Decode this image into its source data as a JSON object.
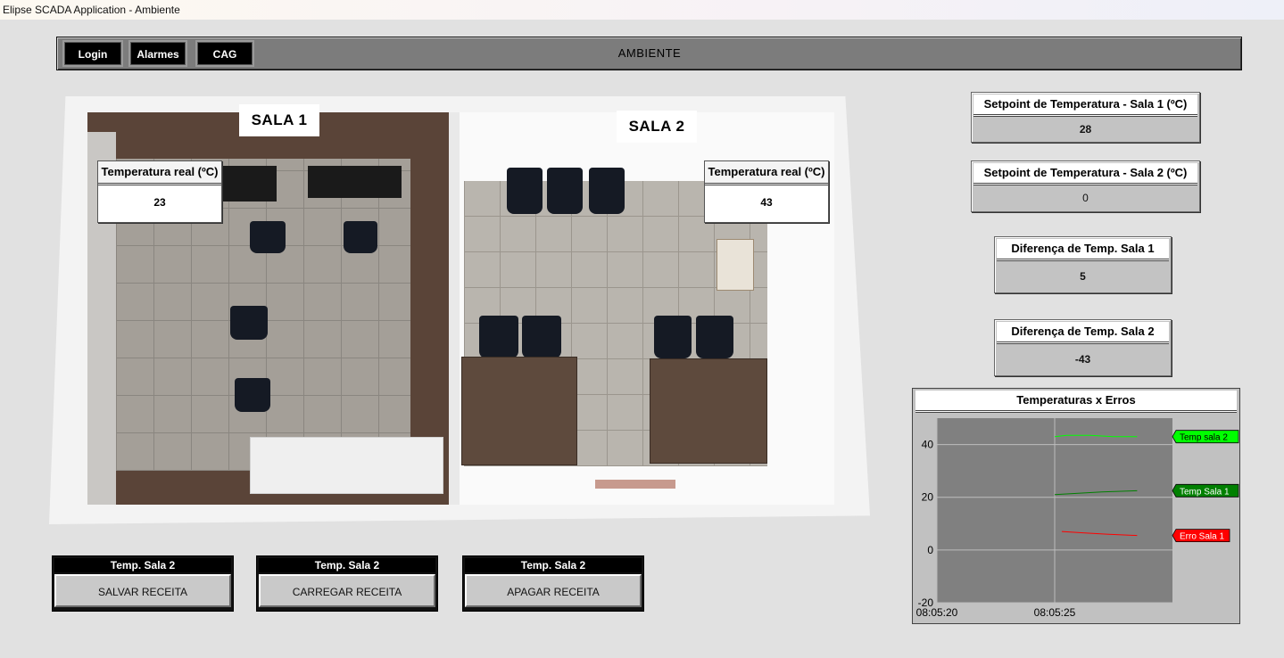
{
  "window": {
    "title": "Elipse SCADA Application - Ambiente"
  },
  "topbar": {
    "buttons": [
      {
        "label": "Login"
      },
      {
        "label": "Alarmes"
      },
      {
        "label": "CAG"
      }
    ],
    "title": "AMBIENTE"
  },
  "plan": {
    "sala1": {
      "label": "SALA 1",
      "temp_title": "Temperatura real (ºC)",
      "temp_value": "23"
    },
    "sala2": {
      "label": "SALA 2",
      "temp_title": "Temperatura real (ºC)",
      "temp_value": "43"
    }
  },
  "panels": {
    "setpoint1": {
      "title": "Setpoint de Temperatura - Sala 1 (ºC)",
      "value": "28"
    },
    "setpoint2": {
      "title": "Setpoint de Temperatura - Sala 2 (ºC)",
      "value": "0"
    },
    "diff1": {
      "title": "Diferença de Temp. Sala 1",
      "value": "5"
    },
    "diff2": {
      "title": "Diferença de Temp. Sala 2",
      "value": "-43"
    }
  },
  "recipes": [
    {
      "header": "Temp. Sala 2",
      "button": "SALVAR RECEITA"
    },
    {
      "header": "Temp. Sala 2",
      "button": "CARREGAR RECEITA"
    },
    {
      "header": "Temp. Sala 2",
      "button": "APAGAR RECEITA"
    }
  ],
  "colors": {
    "temp_sala2": "#00ff00",
    "temp_sala1": "#008000",
    "erro_sala1": "#ff0000",
    "plot_bg": "#808080"
  },
  "chart_data": {
    "type": "line",
    "title": "Temperaturas x Erros",
    "x_ticks": [
      "08:05:20",
      "08:05:25"
    ],
    "y_ticks": [
      40,
      20,
      0,
      -20
    ],
    "ylim": [
      -20,
      50
    ],
    "grid": true,
    "series": [
      {
        "name": "Temp sala 2",
        "color": "#00ff00",
        "x": [
          25.0,
          25.5,
          26.5,
          27.5,
          28.5
        ],
        "y": [
          43,
          43.5,
          43.5,
          43,
          43
        ]
      },
      {
        "name": "Temp Sala 1",
        "color": "#008000",
        "x": [
          25.0,
          26.0,
          27.0,
          28.5
        ],
        "y": [
          21,
          21.5,
          22,
          22.5
        ]
      },
      {
        "name": "Erro Sala 1",
        "color": "#ff0000",
        "x": [
          25.3,
          26.2,
          27.2,
          28.5
        ],
        "y": [
          7,
          6.5,
          6,
          5.5
        ]
      }
    ]
  }
}
